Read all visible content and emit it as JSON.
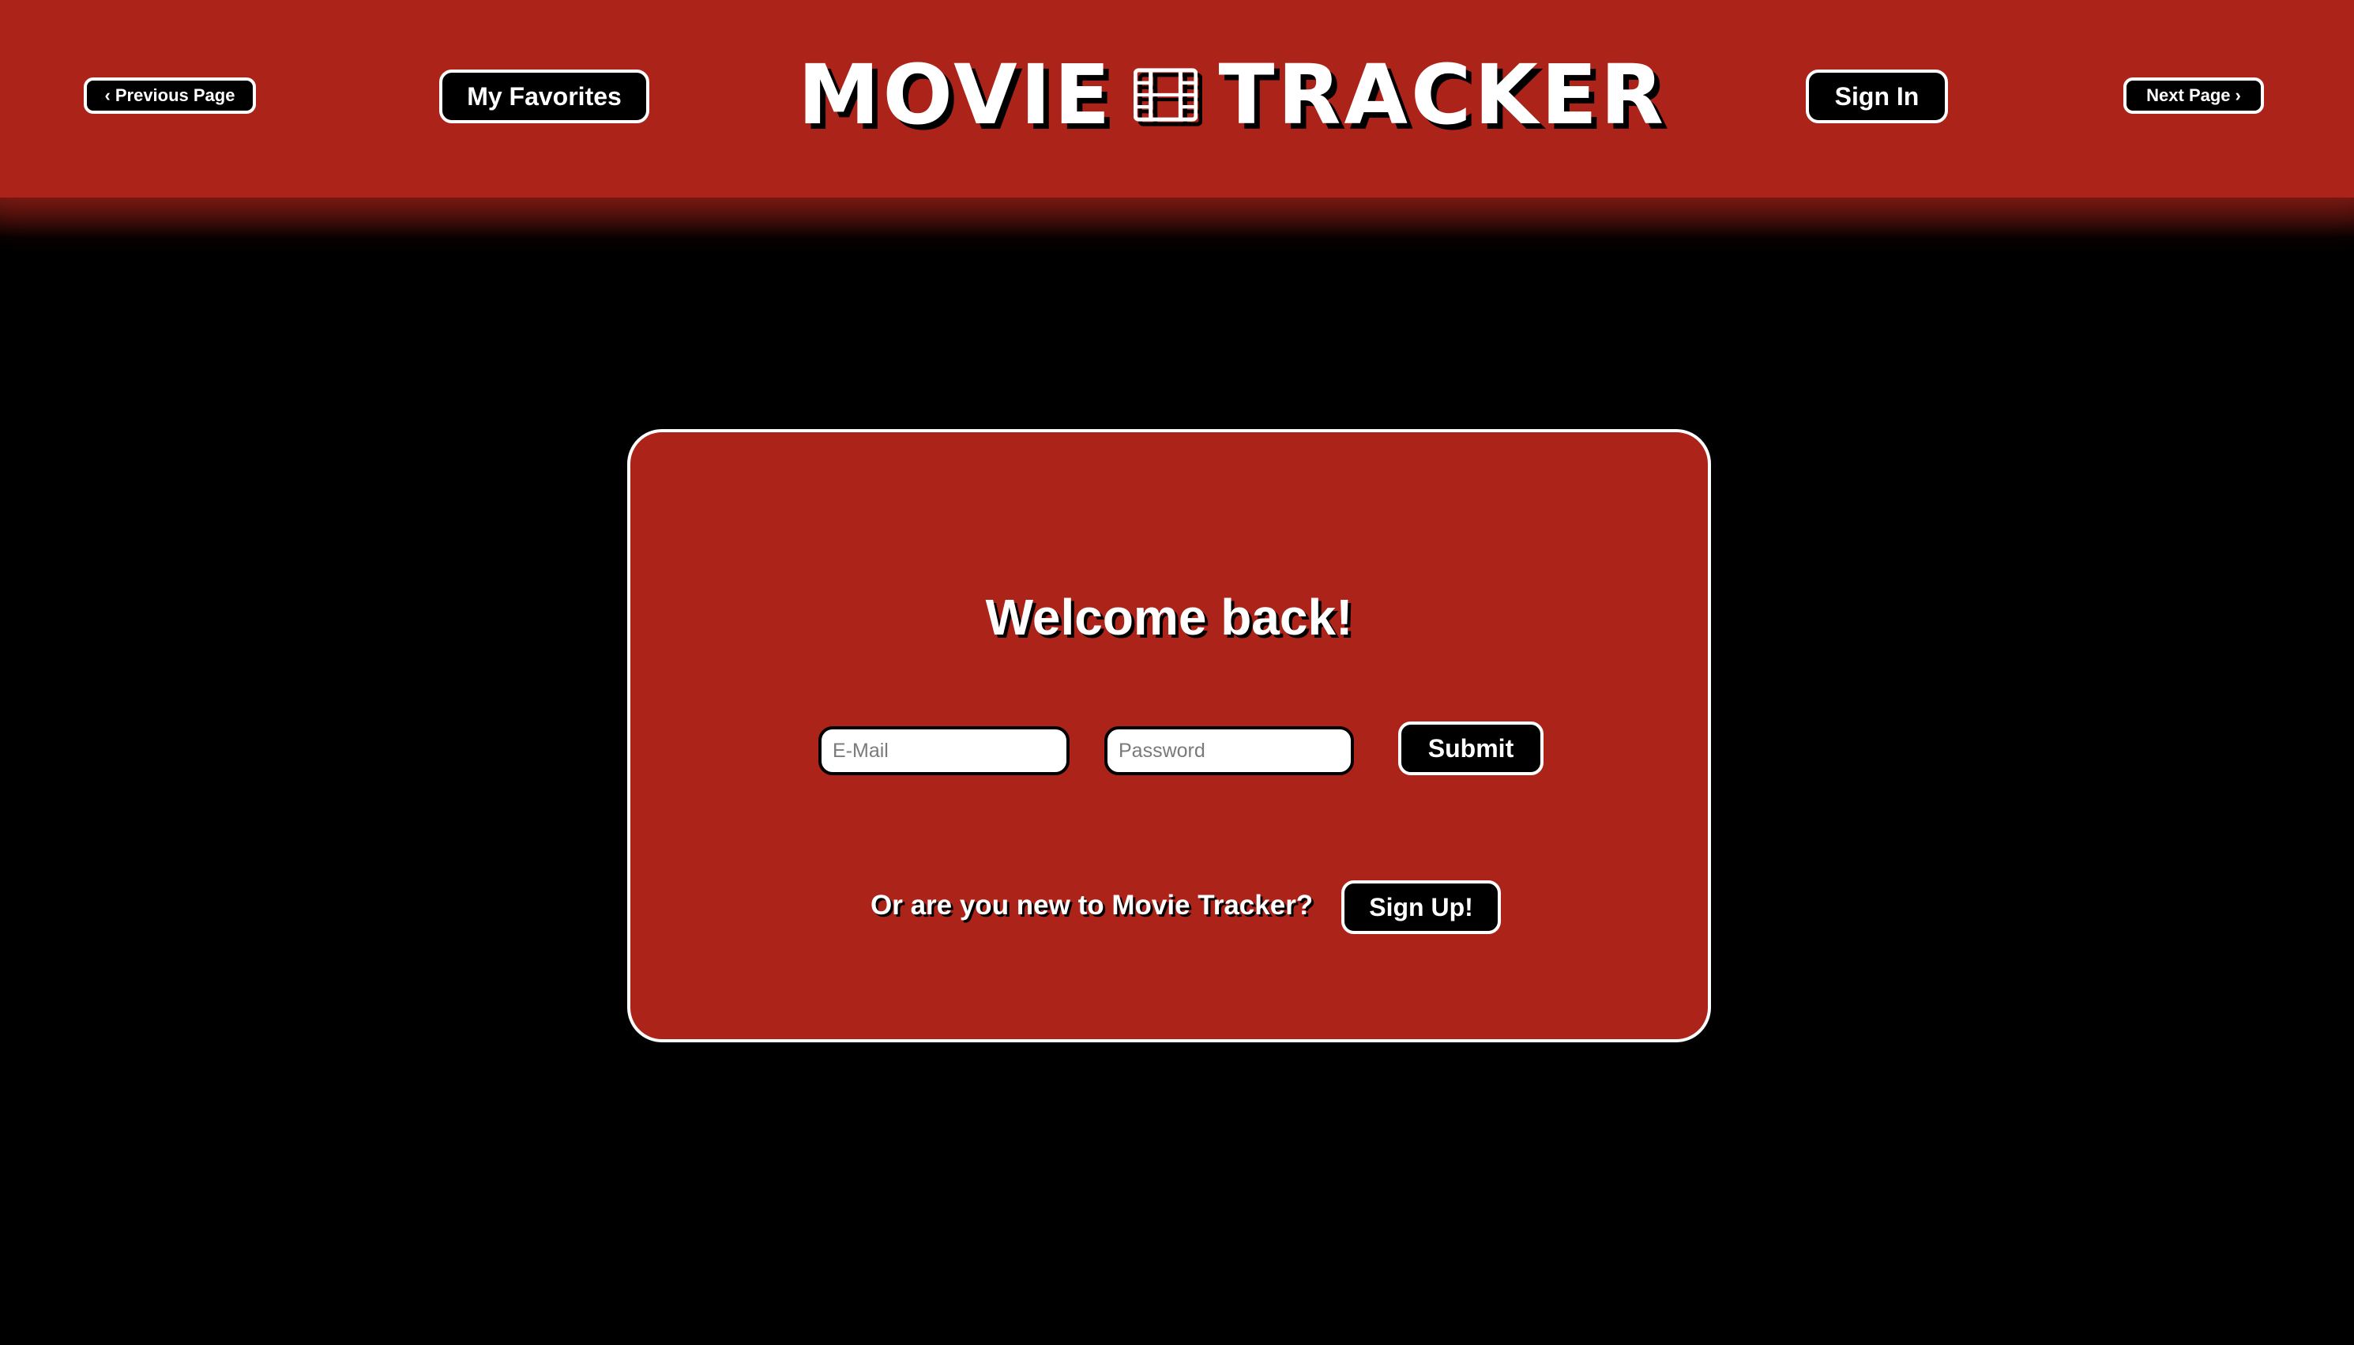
{
  "header": {
    "prev_page_label": "Previous Page",
    "favorites_label": "My Favorites",
    "logo_left": "MOVIE",
    "logo_icon": "film-icon",
    "logo_right": "TRACKER",
    "sign_in_label": "Sign In",
    "next_page_label": "Next Page"
  },
  "login_card": {
    "heading": "Welcome back!",
    "email": {
      "value": "",
      "placeholder": "E-Mail"
    },
    "password": {
      "value": "",
      "placeholder": "Password"
    },
    "submit_label": "Submit",
    "signup_prompt": "Or are you new to Movie Tracker?",
    "signup_label": "Sign Up!"
  },
  "colors": {
    "brand_red": "#ac2319",
    "background": "#000000",
    "button_bg": "#000000",
    "button_text": "#ffffff"
  }
}
